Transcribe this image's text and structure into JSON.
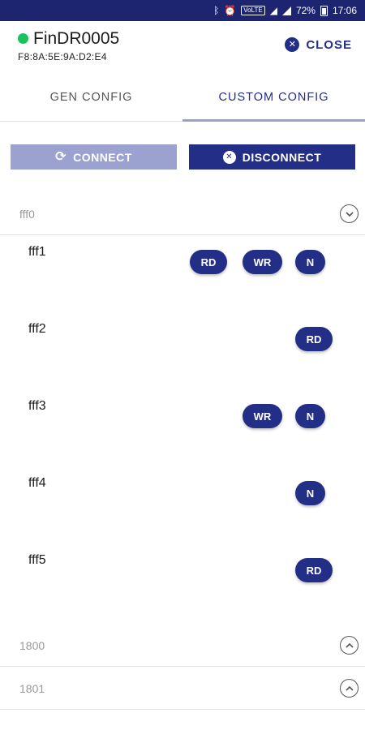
{
  "status_bar": {
    "battery": "72%",
    "time": "17:06",
    "volte": "VoLTE",
    "icons": [
      "bluetooth-icon",
      "alarm-icon",
      "volte-icon",
      "wifi-icon",
      "signal-icon",
      "battery-icon"
    ]
  },
  "device": {
    "name": "FinDR0005",
    "mac": "F8:8A:5E:9A:D2:E4",
    "status_color": "#18c35a"
  },
  "header": {
    "close_label": "CLOSE"
  },
  "tabs": [
    {
      "label": "GEN CONFIG",
      "active": false
    },
    {
      "label": "CUSTOM CONFIG",
      "active": true
    }
  ],
  "actions": {
    "connect_label": "CONNECT",
    "disconnect_label": "DISCONNECT"
  },
  "services": [
    {
      "label": "fff0",
      "expanded": true,
      "characteristics": [
        {
          "label": "fff1",
          "buttons": [
            "RD",
            "WR",
            "N"
          ]
        },
        {
          "label": "fff2",
          "buttons": [
            "RD"
          ]
        },
        {
          "label": "fff3",
          "buttons": [
            "WR",
            "N"
          ]
        },
        {
          "label": "fff4",
          "buttons": [
            "N"
          ]
        },
        {
          "label": "fff5",
          "buttons": [
            "RD"
          ]
        }
      ]
    },
    {
      "label": "1800",
      "expanded": false,
      "characteristics": []
    },
    {
      "label": "1801",
      "expanded": false,
      "characteristics": []
    }
  ],
  "colors": {
    "primary": "#232e86",
    "status_bar": "#1d2570",
    "connect_disabled": "#9ba2d0"
  }
}
